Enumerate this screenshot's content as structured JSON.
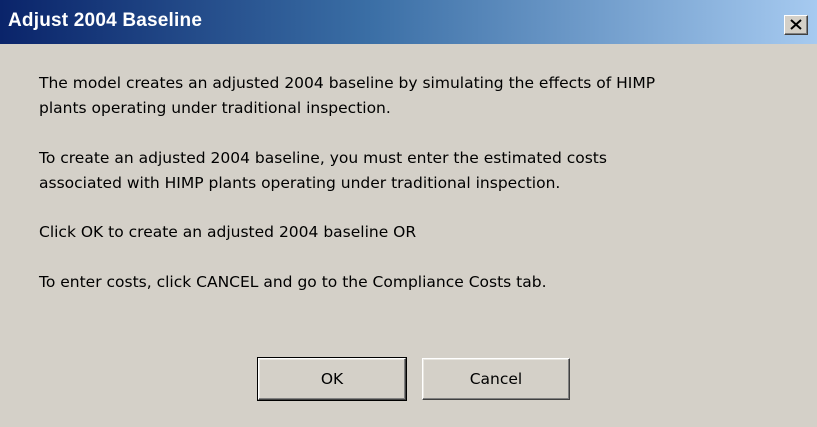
{
  "window": {
    "title": "Adjust 2004 Baseline",
    "close_icon": "close-x-icon"
  },
  "message": {
    "paragraph1_line1": "The model creates an adjusted 2004 baseline by simulating the effects of HIMP",
    "paragraph1_line2": "plants operating under traditional inspection.",
    "paragraph2_line1": "To create an adjusted 2004 baseline, you must enter the estimated costs",
    "paragraph2_line2": "associated with HIMP plants operating under traditional inspection.",
    "paragraph3": "Click OK to create an adjusted 2004 baseline OR",
    "paragraph4": "To enter costs, click CANCEL and go to the Compliance Costs tab."
  },
  "buttons": {
    "ok_label": "OK",
    "cancel_label": "Cancel"
  },
  "colors": {
    "titlebar_start": "#0a246a",
    "titlebar_end": "#a6caf0",
    "dialog_background": "#d4d0c8"
  }
}
